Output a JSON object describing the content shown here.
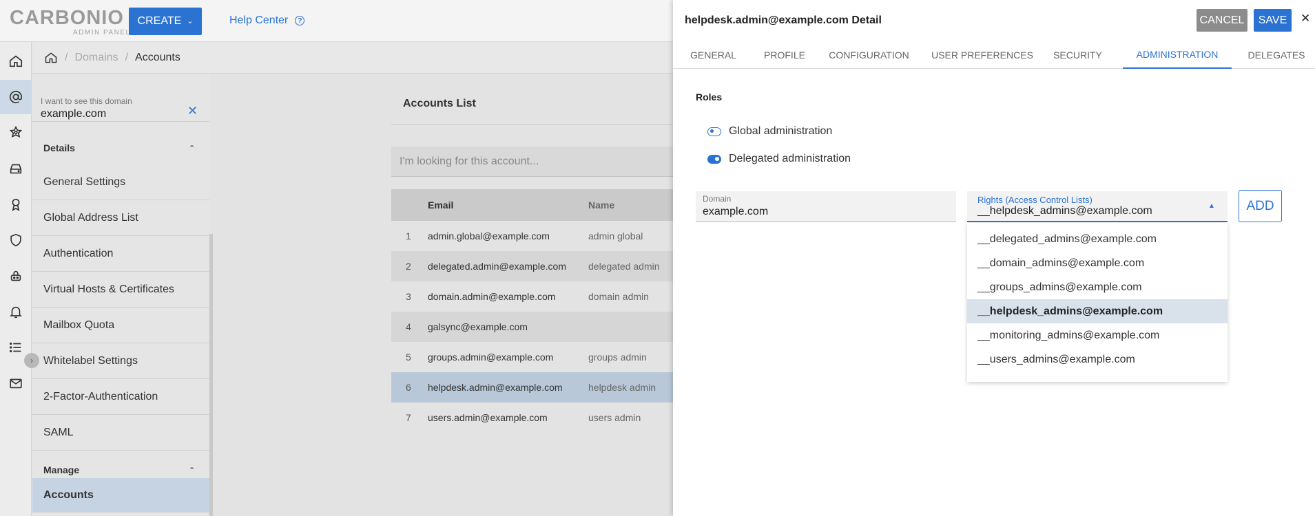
{
  "header": {
    "logo_main": "CARBONIO",
    "logo_sub": "ADMIN PANEL",
    "create_label": "CREATE",
    "help_center_label": "Help Center"
  },
  "rail": {
    "icons": [
      "home-icon",
      "at-domain-icon",
      "cos-icon",
      "storage-icon",
      "subscription-icon",
      "security-icon",
      "backup-icon",
      "notification-icon",
      "list-icon",
      "mail-icon"
    ]
  },
  "breadcrumb": {
    "home_icon": "home-icon",
    "domains": "Domains",
    "accounts": "Accounts"
  },
  "domain_panel": {
    "select_label": "I want to see this domain",
    "select_value": "example.com",
    "details_title": "Details",
    "details_items": [
      "General Settings",
      "Global Address List",
      "Authentication",
      "Virtual Hosts & Certificates",
      "Mailbox Quota",
      "Whitelabel Settings",
      "2-Factor-Authentication",
      "SAML"
    ],
    "manage_title": "Manage",
    "manage_items": [
      "Accounts"
    ]
  },
  "accounts": {
    "title": "Accounts List",
    "search_placeholder": "I'm looking for this account...",
    "columns": [
      "Email",
      "Name"
    ],
    "rows": [
      {
        "num": "1",
        "email": "admin.global@example.com",
        "name": "admin global"
      },
      {
        "num": "2",
        "email": "delegated.admin@example.com",
        "name": "delegated admin"
      },
      {
        "num": "3",
        "email": "domain.admin@example.com",
        "name": "domain admin"
      },
      {
        "num": "4",
        "email": "galsync@example.com",
        "name": ""
      },
      {
        "num": "5",
        "email": "groups.admin@example.com",
        "name": "groups admin"
      },
      {
        "num": "6",
        "email": "helpdesk.admin@example.com",
        "name": "helpdesk admin"
      },
      {
        "num": "7",
        "email": "users.admin@example.com",
        "name": "users admin"
      }
    ],
    "selected_row": 6
  },
  "detail": {
    "title": "helpdesk.admin@example.com Detail",
    "cancel_label": "CANCEL",
    "save_label": "SAVE",
    "tabs": [
      "GENERAL",
      "PROFILE",
      "CONFIGURATION",
      "USER PREFERENCES",
      "SECURITY",
      "ADMINISTRATION",
      "DELEGATES"
    ],
    "active_tab": "ADMINISTRATION",
    "roles_label": "Roles",
    "role_options": [
      {
        "label": "Global administration",
        "checked": false
      },
      {
        "label": "Delegated administration",
        "checked": true
      }
    ],
    "domain_field": {
      "label": "Domain",
      "value": "example.com"
    },
    "rights_field": {
      "label": "Rights (Access Control Lists)",
      "value": "__helpdesk_admins@example.com"
    },
    "add_label": "ADD",
    "rights_options": [
      "__delegated_admins@example.com",
      "__domain_admins@example.com",
      "__groups_admins@example.com",
      "__helpdesk_admins@example.com",
      "__monitoring_admins@example.com",
      "__users_admins@example.com"
    ],
    "rights_selected": "__helpdesk_admins@example.com"
  },
  "colors": {
    "accent": "#2b73d2",
    "cancel_bg": "#8c8c8c",
    "selected_row": "#b9c8d8"
  }
}
